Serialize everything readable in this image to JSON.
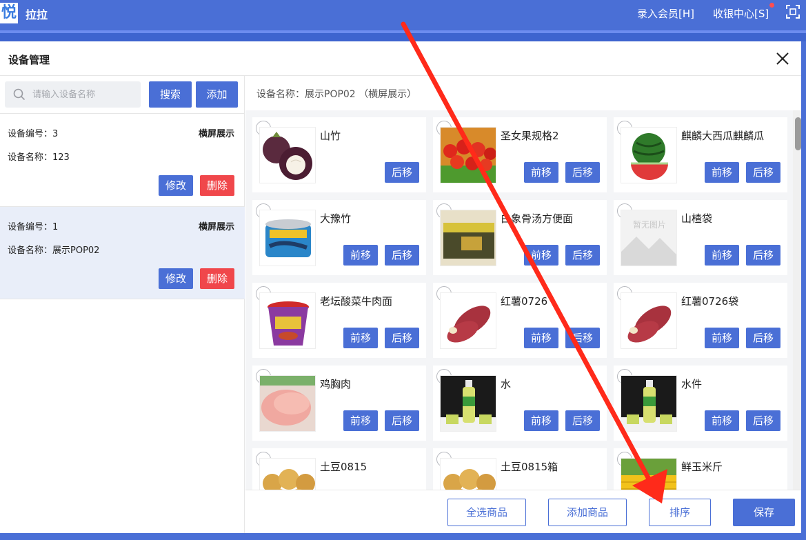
{
  "app": {
    "logo_text": "悦",
    "name": "拉拉"
  },
  "topbar": {
    "member_entry": "录入会员[H]",
    "cashier_center": "收银中心[S]"
  },
  "dialog": {
    "title": "设备管理"
  },
  "left": {
    "search_placeholder": "请输入设备名称",
    "search_label": "搜索",
    "add_label": "添加",
    "devices": [
      {
        "number": "设备编号：3",
        "name": "设备名称：123",
        "mode": "横屏展示",
        "edit": "修改",
        "delete": "删除"
      },
      {
        "number": "设备编号：1",
        "name": "设备名称：展示POP02",
        "mode": "横屏展示",
        "edit": "修改",
        "delete": "删除"
      }
    ]
  },
  "right": {
    "device_info": "设备名称：展示POP02 （横屏展示）",
    "move_forward": "前移",
    "move_back": "后移",
    "products": [
      {
        "name": "山竹",
        "image": "mangosteen-image"
      },
      {
        "name": "圣女果规格2",
        "image": "cherry-tomato-image"
      },
      {
        "name": "麒麟大西瓜麒麟瓜",
        "image": "watermelon-image"
      },
      {
        "name": "大豫竹",
        "image": "canned-fish-image"
      },
      {
        "name": "白象骨汤方便面",
        "image": "instant-noodle-box-image"
      },
      {
        "name": "山楂袋",
        "image": "no-image-placeholder",
        "placeholder_text": "暂无图片"
      },
      {
        "name": "老坛酸菜牛肉面",
        "image": "noodle-cup-image"
      },
      {
        "name": "红薯0726",
        "image": "sweet-potato-image"
      },
      {
        "name": "红薯0726袋",
        "image": "sweet-potato-image"
      },
      {
        "name": "鸡胸肉",
        "image": "chicken-breast-image"
      },
      {
        "name": "水",
        "image": "juice-bottle-image"
      },
      {
        "name": "水件",
        "image": "juice-bottle-image"
      },
      {
        "name": "土豆0815",
        "image": "potato-image"
      },
      {
        "name": "土豆0815箱",
        "image": "potato-image"
      },
      {
        "name": "鲜玉米斤",
        "image": "corn-image"
      }
    ]
  },
  "footer": {
    "select_all": "全选商品",
    "add_product": "添加商品",
    "sort": "排序",
    "save": "保存"
  },
  "colors": {
    "primary": "#4a6fd6",
    "danger": "#f0474b",
    "annotation": "#ff2a1a"
  }
}
